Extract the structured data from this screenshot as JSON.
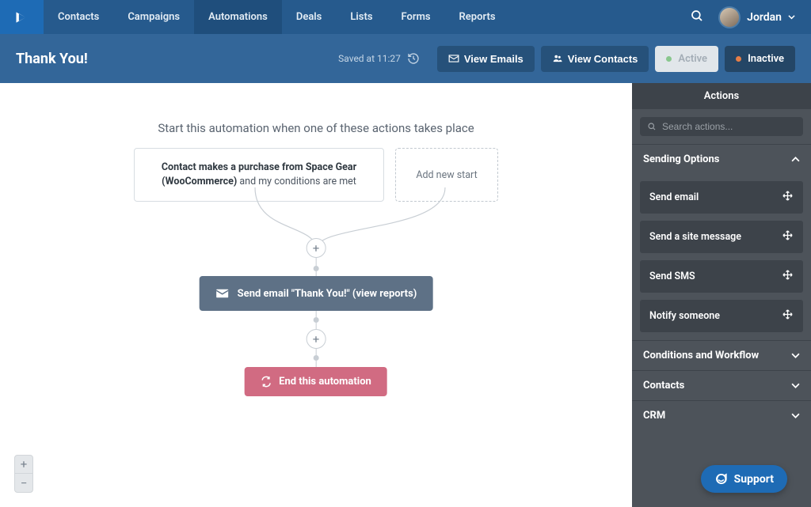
{
  "nav": {
    "items": [
      "Contacts",
      "Campaigns",
      "Automations",
      "Deals",
      "Lists",
      "Forms",
      "Reports"
    ],
    "active_index": 2,
    "user_name": "Jordan"
  },
  "subheader": {
    "title": "Thank You!",
    "saved_at": "Saved at 11:27",
    "view_emails": "View Emails",
    "view_contacts": "View Contacts",
    "active_label": "Active",
    "inactive_label": "Inactive"
  },
  "canvas": {
    "start_prompt": "Start this automation when one of these actions takes place",
    "trigger_bold": "Contact makes a purchase from Space Gear (WooCommerce)",
    "trigger_rest": " and my conditions are met",
    "add_new_start": "Add new start",
    "email_node": "Send email \"Thank You!\" (view reports)",
    "end_node": "End this automation"
  },
  "panel": {
    "title": "Actions",
    "search_placeholder": "Search actions...",
    "sections": {
      "sending_options": {
        "label": "Sending Options",
        "open": true,
        "items": [
          "Send email",
          "Send a site message",
          "Send SMS",
          "Notify someone"
        ]
      },
      "conditions": {
        "label": "Conditions and Workflow"
      },
      "contacts": {
        "label": "Contacts"
      },
      "crm": {
        "label": "CRM"
      }
    }
  },
  "support": {
    "label": "Support"
  }
}
